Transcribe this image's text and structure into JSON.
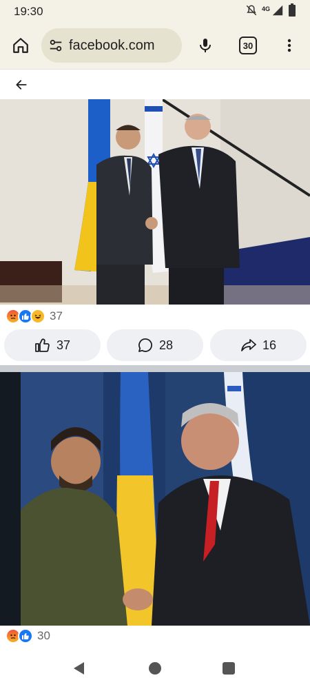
{
  "status_bar": {
    "time": "19:30",
    "network": "4G"
  },
  "browser": {
    "url": "facebook.com",
    "tab_count": "30"
  },
  "post1": {
    "photo_alt": "Two men in suits shaking hands in front of Ukrainian and Israeli flags",
    "reactions": [
      "angry",
      "like",
      "haha"
    ],
    "reaction_count": "37",
    "like_count": "37",
    "comment_count": "28",
    "share_count": "16"
  },
  "post2": {
    "photo_alt": "Two men shaking hands in front of a blue backdrop with Ukrainian and Israeli flags",
    "reactions": [
      "angry",
      "like"
    ],
    "reaction_count": "30"
  },
  "colors": {
    "chrome_bg": "#f4f1e6",
    "url_pill": "#e5e2cf",
    "fb_blue": "#1877f2",
    "button_bg": "#eef0f3"
  }
}
